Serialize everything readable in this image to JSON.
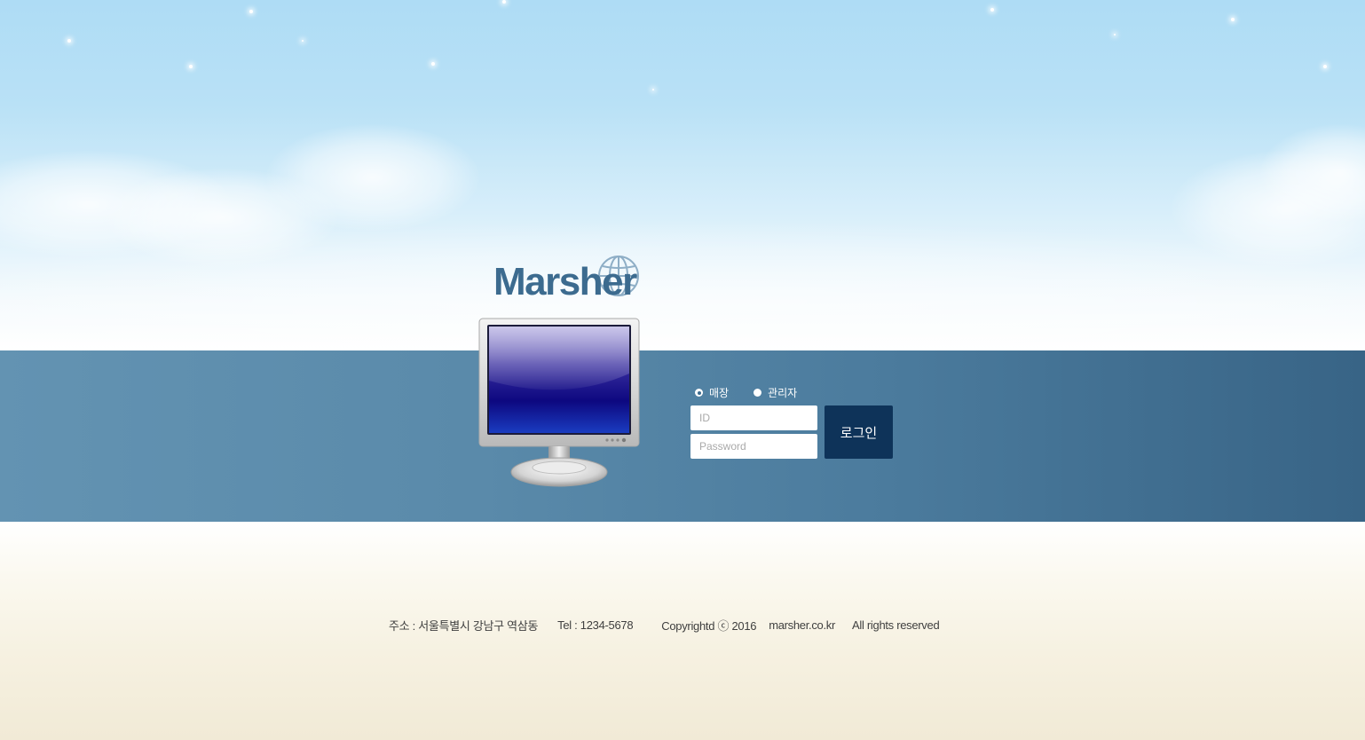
{
  "logo": {
    "text": "Marsher",
    "icon": "globe-icon"
  },
  "login": {
    "login_types": [
      {
        "label": "매장",
        "selected": true
      },
      {
        "label": "관리자",
        "selected": false
      }
    ],
    "id_placeholder": "ID",
    "password_placeholder": "Password",
    "login_button_label": "로그인"
  },
  "footer": {
    "address": "주소 : 서울특별시 강남구 역삼동",
    "tel": "Tel : 1234-5678",
    "copyright": "Copyrightd ⓒ 2016",
    "domain": "marsher.co.kr",
    "rights": "All rights reserved"
  },
  "colors": {
    "band": "#4b7b9d",
    "login_button": "#0e3359",
    "logo_text": "#3c6b8f"
  }
}
